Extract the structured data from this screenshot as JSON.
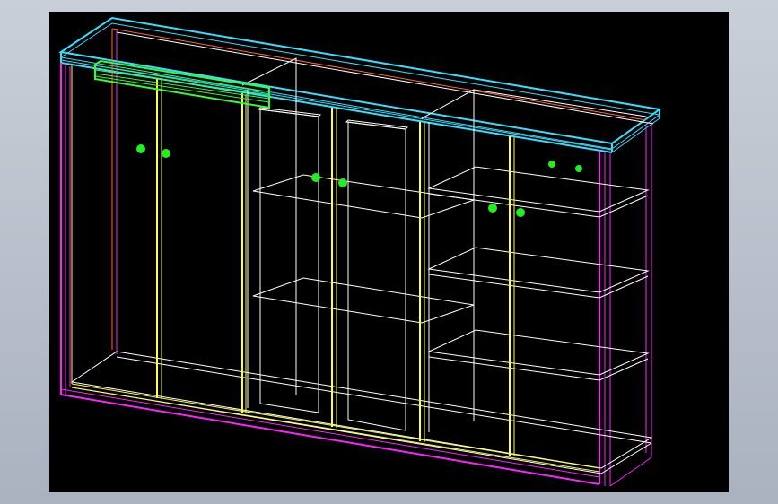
{
  "viewport": {
    "background": "#000000",
    "window_background": "#b8bfca"
  },
  "colors": {
    "carcass": "#ff22ff",
    "door_frame": "#ffff33",
    "shelf": "#ffffff",
    "top_panel": "#33e0ff",
    "back_edge": "#ff6633",
    "handle_and_rail": "#22ee22"
  },
  "icons": [
    "wardrobe-wireframe",
    "door-knob-icon",
    "sliding-rail-icon"
  ]
}
